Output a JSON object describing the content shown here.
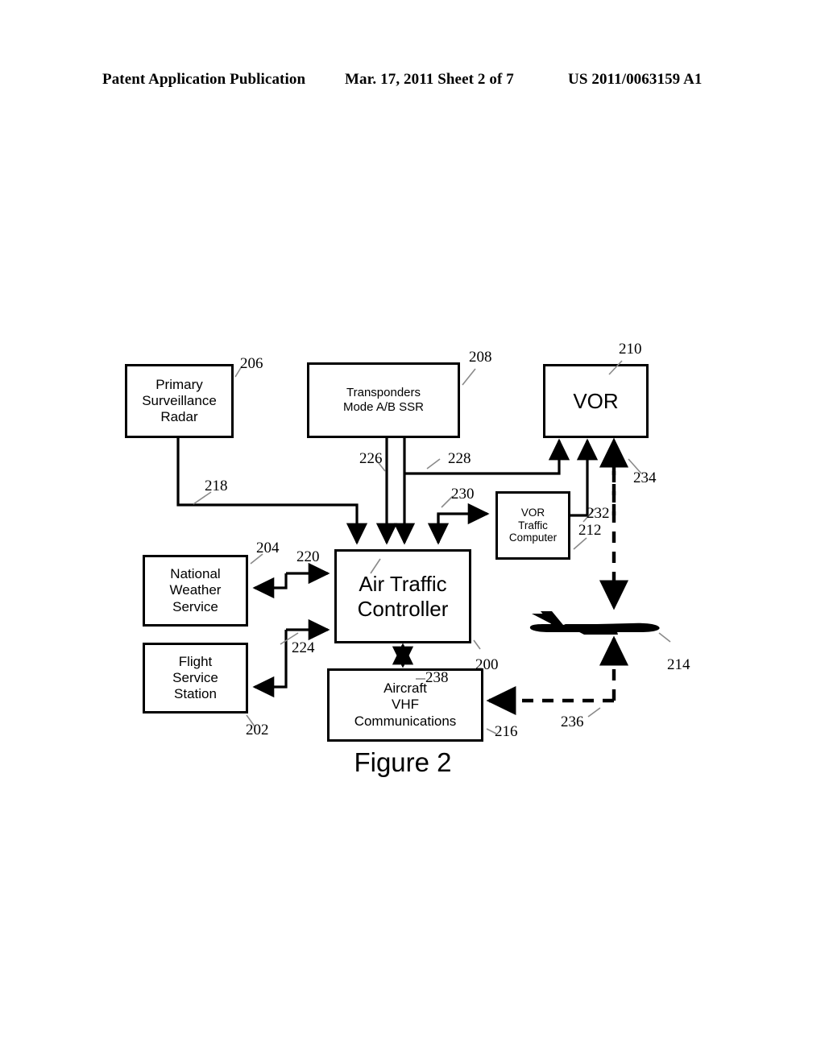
{
  "header": {
    "left": "Patent Application Publication",
    "middle": "Mar. 17, 2011  Sheet 2 of 7",
    "right": "US 2011/0063159 A1"
  },
  "figure": {
    "caption": "Figure 2",
    "nodes": [
      {
        "id": "psr",
        "label": "Primary\nSurveillance\nRadar",
        "ref": "206"
      },
      {
        "id": "trans",
        "label": "Transponders\nMode A/B SSR",
        "ref": "208"
      },
      {
        "id": "vor",
        "label": "VOR",
        "ref": "210"
      },
      {
        "id": "vtc",
        "label": "VOR\nTraffic\nComputer",
        "ref": "212"
      },
      {
        "id": "nws",
        "label": "National\nWeather\nService",
        "ref": "204"
      },
      {
        "id": "atc",
        "label": "Air Traffic\nController",
        "ref": "200"
      },
      {
        "id": "fss",
        "label": "Flight\nService\nStation",
        "ref": "202"
      },
      {
        "id": "vhf",
        "label": "Aircraft\nVHF\nCommunications",
        "ref": "216"
      },
      {
        "id": "aircraft",
        "label": "",
        "ref": "214"
      }
    ],
    "connector_refs": {
      "r218": "218",
      "r220": "220",
      "r224": "224",
      "r226": "226",
      "r228": "228",
      "r230": "230",
      "r232": "232",
      "r234": "234",
      "r236": "236",
      "r238": "238"
    },
    "colors": {
      "ink": "#000000",
      "paper": "#ffffff"
    }
  }
}
